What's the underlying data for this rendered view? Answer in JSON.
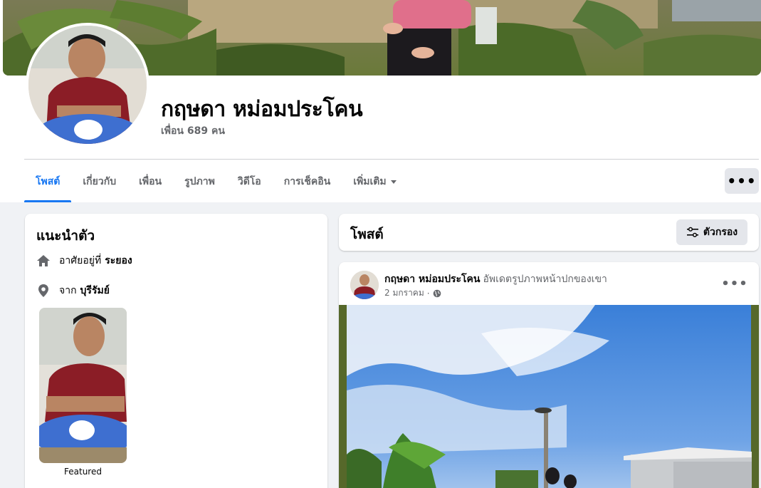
{
  "profile": {
    "name": "กฤษดา หม่อมประโคน",
    "friends": "เพื่อน 689 คน"
  },
  "tabs": [
    {
      "label": "โพสต์",
      "active": true
    },
    {
      "label": "เกี่ยวกับ"
    },
    {
      "label": "เพื่อน"
    },
    {
      "label": "รูปภาพ"
    },
    {
      "label": "วิดีโอ"
    },
    {
      "label": "การเช็คอิน"
    },
    {
      "label": "เพิ่มเติม",
      "dropdown": true
    }
  ],
  "more_button": "more-dots-icon",
  "intro": {
    "title": "แนะนำตัว",
    "lives_prefix": "อาศัยอยู่ที่",
    "lives_place": "ระยอง",
    "from_prefix": "จาก",
    "from_place": "บุรีรัมย์",
    "featured_label": "Featured"
  },
  "posts": {
    "title": "โพสต์",
    "filter_label": "ตัวกรอง"
  },
  "post": {
    "author": "กฤษดา หม่อมประโคน",
    "action": "อัพเดตรูปภาพหน้าปกของเขา",
    "date": "2 มกราคม",
    "privacy_icon": "globe-icon"
  },
  "colors": {
    "accent": "#1877f2",
    "secondary_text": "#65676b",
    "button_bg": "#e4e6eb",
    "page_bg": "#f0f2f5"
  }
}
